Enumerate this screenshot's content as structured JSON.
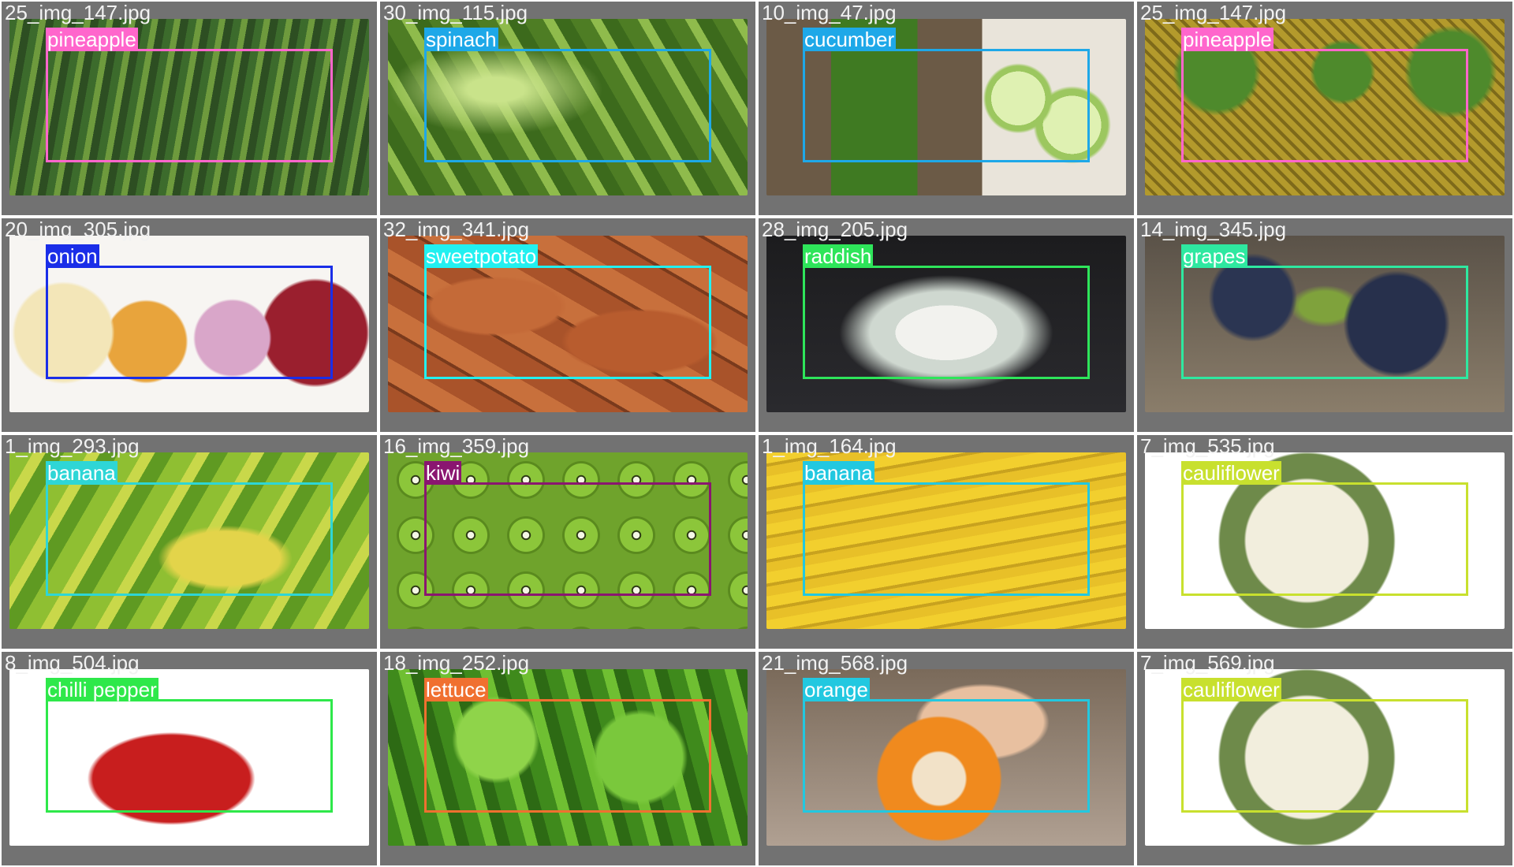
{
  "tiles": [
    {
      "file": "25_img_147.jpg",
      "label": "pineapple",
      "color": "#ff66cc",
      "bg": "repeating-linear-gradient(100deg,#3c6b2c 0 10px,#6e9a3d 10px 18px,#2d4e22 18px 28px),radial-gradient(circle at 50% 40%,#a07040,#5e3f22)"
    },
    {
      "file": "30_img_115.jpg",
      "label": "spinach",
      "color": "#1ea8e8",
      "bg": "radial-gradient(ellipse at 30% 40%,#c9e38a 0 8%,transparent 30%),repeating-linear-gradient(60deg,#4e7d24 0 22px,#8fbb4c 22px 34px,#3c6a1c 34px 52px)"
    },
    {
      "file": "10_img_47.jpg",
      "label": "cucumber",
      "color": "#1ea8e8",
      "bg": "radial-gradient(circle at 70% 45%,#dff1b2 0 10%,#9cc75f 10% 12%,transparent 13%),radial-gradient(circle at 85% 60%,#dff1b2 0 9%,#9cc75f 9% 11%,transparent 12%),linear-gradient(90deg,#6b5a46 0 18%,#3f7a22 18% 42%,#6b5a46 42% 60%,#e9e4da 60%)"
    },
    {
      "file": "25_img_147.jpg",
      "label": "pineapple",
      "color": "#ff66cc",
      "bg": "radial-gradient(circle at 20% 30%,#4e8a2c 0 12%,transparent 14%),radial-gradient(circle at 55% 30%,#4e8a2c 0 12%,transparent 14%),radial-gradient(circle at 85% 30%,#4e8a2c 0 12%,transparent 14%),repeating-linear-gradient(45deg,#b39a2c 0 8px,#7e6a1a 8px 12px),linear-gradient(#c8a835,#8e7320)"
    },
    {
      "file": "20_img_305.jpg",
      "label": "onion",
      "color": "#1a2ee8",
      "bg": "radial-gradient(circle at 15% 55%,#f3e6b8 0 15%,transparent 16%),radial-gradient(circle at 38% 60%,#e8a43c 0 16%,transparent 17%),radial-gradient(circle at 62% 58%,#d9a6c9 0 15%,transparent 16%),radial-gradient(circle at 85% 55%,#9a1f2e 0 16%,transparent 17%),#f7f5f2"
    },
    {
      "file": "32_img_341.jpg",
      "label": "sweetpotato",
      "color": "#22f0f0",
      "bg": "radial-gradient(ellipse at 30% 40%,#c46a38 0 18%,transparent 20%),radial-gradient(ellipse at 70% 60%,#b85c2e 0 20%,transparent 22%),repeating-linear-gradient(30deg,#a9532a 0 30px,#7a3a1c 30px 34px,#c8703c 34px 60px)"
    },
    {
      "file": "28_img_205.jpg",
      "label": "raddish",
      "color": "#2ee55a",
      "bg": "radial-gradient(ellipse at 50% 55%,#f2f2ee 0 20%,#cfd8d0 20% 30%,transparent 42%),linear-gradient(#1c1c1e,#2a2a2e)"
    },
    {
      "file": "14_img_345.jpg",
      "label": "grapes",
      "color": "#2ee8a0",
      "bg": "radial-gradient(circle at 30% 35%,#2b3552 0 14%,transparent 16%),radial-gradient(circle at 70% 50%,#27304c 0 18%,transparent 20%),radial-gradient(ellipse at 50% 40%,#7fa23c 0 10%,transparent 14%),linear-gradient(#5a5248,#8a7d6a)"
    },
    {
      "file": "1_img_293.jpg",
      "label": "banana",
      "color": "#2ed6d6",
      "bg": "radial-gradient(ellipse at 60% 60%,#e3d44a 0 18%,transparent 22%),repeating-linear-gradient(120deg,#8fbf32 0 26px,#c9d84a 26px 40px,#5f9a22 40px 60px)"
    },
    {
      "file": "16_img_359.jpg",
      "label": "kiwi",
      "color": "#8a1670",
      "bg": "radial-gradient(circle,#f5f7e6 0 8%,#2d3a14 9% 12%,#8cc63a 13% 42%,#5a8a1e 43% 48%,transparent 49%) 0 0/70px 70px,#6fa32c"
    },
    {
      "file": "1_img_164.jpg",
      "label": "banana",
      "color": "#22c8e0",
      "bg": "repeating-linear-gradient(170deg,#f2cf2e 0 14px,#c8a21e 14px 18px,#e8c028 18px 30px)"
    },
    {
      "file": "7_img_535.jpg",
      "label": "cauliflower",
      "color": "#c8e02e",
      "bg": "radial-gradient(circle at 45% 50%,#f2eedd 0 28%,#6e8a4a 29% 40%,transparent 41%),#ffffff"
    },
    {
      "file": "8_img_504.jpg",
      "label": "chilli pepper",
      "color": "#2ee84a",
      "bg": "radial-gradient(ellipse at 45% 62%,#c81e1e 0 28%,transparent 30%),#ffffff"
    },
    {
      "file": "18_img_252.jpg",
      "label": "lettuce",
      "color": "#f07030",
      "bg": "radial-gradient(circle at 30% 40%,#8fd44a 0 14%,transparent 16%),radial-gradient(circle at 70% 50%,#7ac83c 0 16%,transparent 18%),repeating-linear-gradient(75deg,#3f8a1c 0 20px,#6fbf32 20px 34px,#2d6a14 34px 50px)"
    },
    {
      "file": "21_img_568.jpg",
      "label": "orange",
      "color": "#22c8e0",
      "bg": "radial-gradient(circle at 48% 62%,#f2e2c8 0 12%,#f08a1e 13% 28%,transparent 29%),radial-gradient(ellipse at 60% 30%,#e8c0a0 0 20%,transparent 22%),linear-gradient(#7a6a5a,#b0a092)"
    },
    {
      "file": "7_img_569.jpg",
      "label": "cauliflower",
      "color": "#c8e02e",
      "bg": "radial-gradient(circle at 45% 50%,#f2eedd 0 28%,#6e8a4a 29% 40%,transparent 41%),#ffffff"
    }
  ]
}
